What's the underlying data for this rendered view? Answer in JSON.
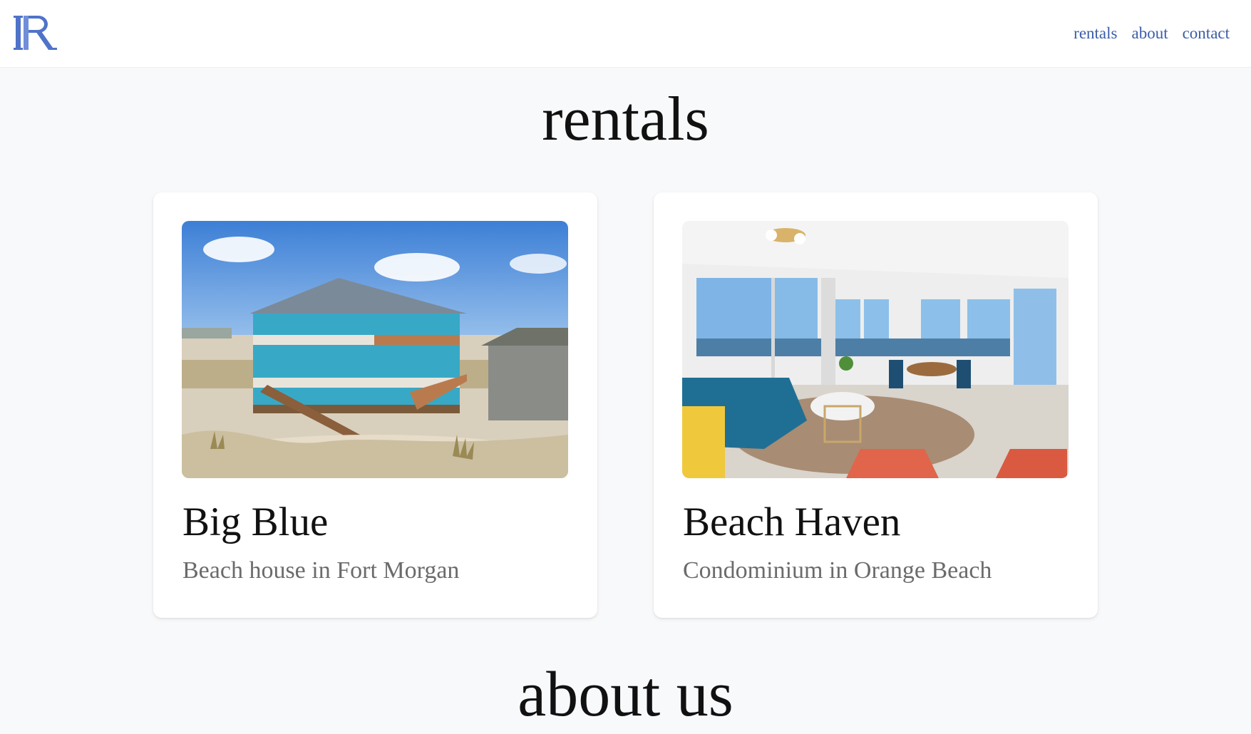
{
  "header": {
    "logo_alt": "RR",
    "nav": [
      {
        "label": "rentals"
      },
      {
        "label": "about"
      },
      {
        "label": "contact"
      }
    ],
    "accent_color": "#3b5da8"
  },
  "rentals": {
    "title": "rentals",
    "cards": [
      {
        "name": "Big Blue",
        "description": "Beach house in Fort Morgan",
        "image": "beach-house-photo"
      },
      {
        "name": "Beach Haven",
        "description": "Condominium in Orange Beach",
        "image": "condo-living-room-photo"
      }
    ]
  },
  "about": {
    "title": "about us"
  }
}
